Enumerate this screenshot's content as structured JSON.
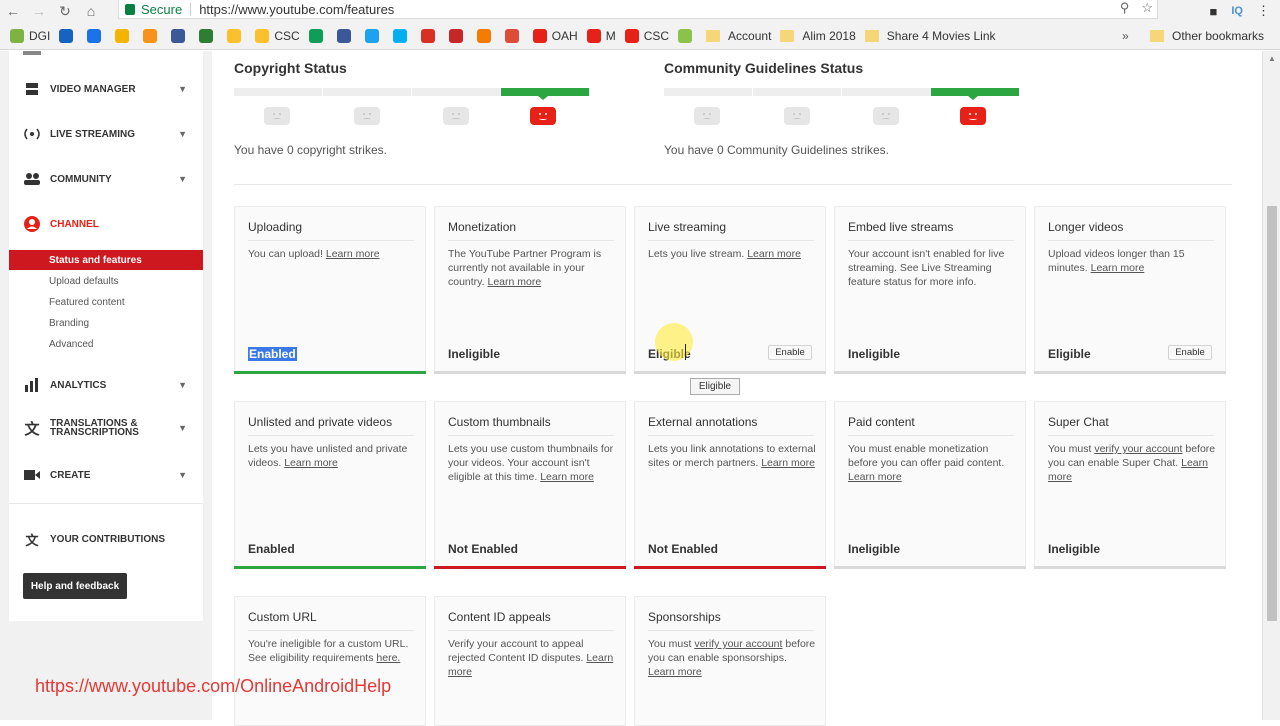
{
  "browser": {
    "secure_label": "Secure",
    "url": "https://www.youtube.com/features",
    "ext_badge": "IQ",
    "bookmarks": [
      {
        "label": "DGI",
        "color": "#7cb342"
      },
      {
        "label": "",
        "color": "#1565c0"
      },
      {
        "label": "",
        "color": "#1a73e8"
      },
      {
        "label": "",
        "color": "#f4b400"
      },
      {
        "label": "",
        "color": "#f7931a"
      },
      {
        "label": "",
        "color": "#3b5998"
      },
      {
        "label": "",
        "color": "#2e7d32"
      },
      {
        "label": "",
        "color": "#fbc02d"
      },
      {
        "label": "CSC",
        "color": "#fbc02d"
      },
      {
        "label": "",
        "color": "#0f9d58"
      },
      {
        "label": "",
        "color": "#3b5998"
      },
      {
        "label": "",
        "color": "#1da1f2"
      },
      {
        "label": "",
        "color": "#00aff0"
      },
      {
        "label": "",
        "color": "#d93025"
      },
      {
        "label": "",
        "color": "#c62828"
      },
      {
        "label": "",
        "color": "#f57c00"
      },
      {
        "label": "",
        "color": "#dd4b39"
      },
      {
        "label": "OAH",
        "color": "#e62117"
      },
      {
        "label": "M",
        "color": "#e62117"
      },
      {
        "label": "CSC",
        "color": "#e62117"
      },
      {
        "label": "",
        "color": "#8bc34a"
      }
    ],
    "folders": [
      "Account",
      "Alim 2018",
      "Share 4 Movies Link"
    ],
    "other_bookmarks": "Other bookmarks"
  },
  "sidebar": {
    "items": [
      {
        "label": "Video Manager",
        "icon": "video-manager-icon"
      },
      {
        "label": "Live Streaming",
        "icon": "live-streaming-icon"
      },
      {
        "label": "Community",
        "icon": "community-icon"
      },
      {
        "label": "Channel",
        "icon": "channel-icon"
      }
    ],
    "sub_items": [
      "Status and features",
      "Upload defaults",
      "Featured content",
      "Branding",
      "Advanced"
    ],
    "lower_items": [
      {
        "label": "Analytics",
        "icon": "analytics-icon"
      },
      {
        "label": "Translations &",
        "label2": "Transcriptions",
        "icon": "translate-icon"
      },
      {
        "label": "Create",
        "icon": "create-icon"
      }
    ],
    "contributions": "Your Contributions",
    "help_button": "Help and feedback"
  },
  "status": {
    "copyright_title": "Copyright Status",
    "copyright_text": "You have 0 copyright strikes.",
    "community_title": "Community Guidelines Status",
    "community_text": "You have 0 Community Guidelines strikes."
  },
  "features": [
    {
      "title": "Uploading",
      "desc": "You can upload!",
      "link": "Learn more",
      "status": "Enabled",
      "bar": "green",
      "selected": true
    },
    {
      "title": "Monetization",
      "desc": "The YouTube Partner Program is currently not available in your country.",
      "link": "Learn more",
      "status": "Ineligible",
      "bar": "grey"
    },
    {
      "title": "Live streaming",
      "desc": "Lets you live stream.",
      "link": "Learn more",
      "status": "Eligible",
      "bar": "grey",
      "button": "Enable"
    },
    {
      "title": "Embed live streams",
      "desc": "Your account isn't enabled for live streaming. See Live Streaming feature status for more info.",
      "link": "",
      "status": "Ineligible",
      "bar": "grey"
    },
    {
      "title": "Longer videos",
      "desc": "Upload videos longer than 15 minutes.",
      "link": "Learn more",
      "status": "Eligible",
      "bar": "grey",
      "button": "Enable"
    },
    {
      "title": "Unlisted and private videos",
      "desc": "Lets you have unlisted and private videos.",
      "link": "Learn more",
      "status": "Enabled",
      "bar": "green"
    },
    {
      "title": "Custom thumbnails",
      "desc": "Lets you use custom thumbnails for your videos. Your account isn't eligible at this time.",
      "link": "Learn more",
      "status": "Not Enabled",
      "bar": "red"
    },
    {
      "title": "External annotations",
      "desc": "Lets you link annotations to external sites or merch partners.",
      "link": "Learn more",
      "status": "Not Enabled",
      "bar": "red"
    },
    {
      "title": "Paid content",
      "desc": "You must enable monetization before you can offer paid content.",
      "link": "Learn more",
      "status": "Ineligible",
      "bar": "grey"
    },
    {
      "title": "Super Chat",
      "desc_pre": "You must",
      "desc_link": "verify your account",
      "desc": "before you can enable Super Chat.",
      "link": "Learn more",
      "status": "Ineligible",
      "bar": "grey"
    },
    {
      "title": "Custom URL",
      "desc": "You're ineligible for a custom URL. See eligibility requirements",
      "link": "here.",
      "status": "",
      "bar": "none"
    },
    {
      "title": "Content ID appeals",
      "desc": "Verify your account to appeal rejected Content ID disputes.",
      "link": "Learn more",
      "status": "",
      "bar": "none"
    },
    {
      "title": "Sponsorships",
      "desc_pre": "You must",
      "desc_link": "verify your account",
      "desc": "before you can enable sponsorships.",
      "link": "Learn more",
      "status": "",
      "bar": "none"
    }
  ],
  "tooltip": "Eligible",
  "watermark": "https://www.youtube.com/OnlineAndroidHelp"
}
